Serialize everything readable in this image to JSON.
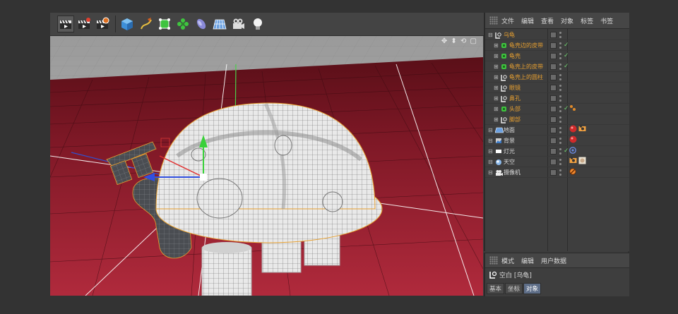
{
  "toolbar": {
    "buttons": [
      {
        "icon": "render-view-icon"
      },
      {
        "icon": "render-to-picture-viewer-icon"
      },
      {
        "icon": "render-settings-icon"
      },
      {
        "icon": "cube-primitive-icon"
      },
      {
        "icon": "pen-spline-icon"
      },
      {
        "icon": "nurbs-generator-icon"
      },
      {
        "icon": "array-modeling-icon"
      },
      {
        "icon": "deformer-bend-icon"
      },
      {
        "icon": "floor-scene-icon"
      },
      {
        "icon": "camera-icon"
      },
      {
        "icon": "light-bulb-icon"
      }
    ]
  },
  "viewport": {
    "nav_icons": "✥ ⬍ ⟲ ▢"
  },
  "object_manager": {
    "menus": [
      "文件",
      "编辑",
      "查看",
      "对象",
      "标签",
      "书签"
    ],
    "objects": [
      {
        "name": "乌龟",
        "level": 0,
        "color": "#e8a030",
        "icon": "null-object-icon",
        "check": false,
        "tags": []
      },
      {
        "name": "龟壳边的皮带",
        "level": 1,
        "color": "#e8a030",
        "icon": "subdivision-surface-icon",
        "check": true,
        "tags": []
      },
      {
        "name": "龟壳",
        "level": 1,
        "color": "#e8a030",
        "icon": "subdivision-surface-icon",
        "check": true,
        "tags": []
      },
      {
        "name": "龟壳上的皮带",
        "level": 1,
        "color": "#e8a030",
        "icon": "subdivision-surface-icon",
        "check": true,
        "tags": []
      },
      {
        "name": "龟壳上的圆柱",
        "level": 1,
        "color": "#e8a030",
        "icon": "null-object-icon",
        "check": false,
        "tags": []
      },
      {
        "name": "眼镜",
        "level": 1,
        "color": "#e8a030",
        "icon": "null-object-icon",
        "check": false,
        "tags": []
      },
      {
        "name": "鼻孔",
        "level": 1,
        "color": "#e8a030",
        "icon": "null-object-icon",
        "check": false,
        "tags": []
      },
      {
        "name": "头部",
        "level": 1,
        "color": "#e8a030",
        "icon": "subdivision-surface-icon",
        "check": true,
        "tags": [
          "phong-tag-icon"
        ]
      },
      {
        "name": "脚部",
        "level": 1,
        "color": "#e8a030",
        "icon": "null-object-icon",
        "check": false,
        "tags": []
      },
      {
        "name": "地面",
        "level": 0,
        "color": "#d8d8d8",
        "icon": "floor-icon",
        "check": false,
        "tags": [
          "material-red-icon",
          "compositing-tag-icon"
        ]
      },
      {
        "name": "背景",
        "level": 0,
        "color": "#d8d8d8",
        "icon": "background-icon",
        "check": false,
        "tags": [
          "material-red-icon"
        ]
      },
      {
        "name": "灯光",
        "level": 0,
        "color": "#d8d8d8",
        "icon": "light-icon",
        "check": true,
        "tags": [
          "target-tag-icon"
        ]
      },
      {
        "name": "天空",
        "level": 0,
        "color": "#d8d8d8",
        "icon": "sky-icon",
        "check": false,
        "tags": [
          "compositing-tag-icon",
          "sky-texture-icon"
        ]
      },
      {
        "name": "摄像机",
        "level": 0,
        "color": "#d8d8d8",
        "icon": "camera-object-icon",
        "check": false,
        "tags": [
          "protection-tag-icon"
        ]
      }
    ]
  },
  "attributes": {
    "menus": [
      "模式",
      "编辑",
      "用户数据"
    ],
    "title": "空白 [乌龟]",
    "tabs": [
      "基本",
      "坐标",
      "对象"
    ],
    "active_tab": "对象"
  }
}
